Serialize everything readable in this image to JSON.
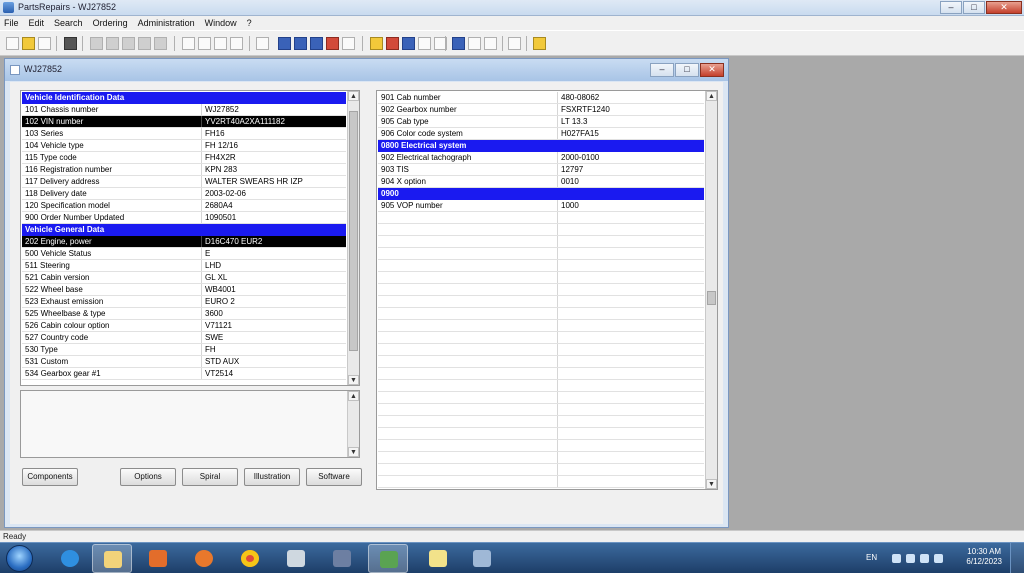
{
  "app": {
    "title": "PartsRepairs - WJ27852",
    "menu": [
      "File",
      "Edit",
      "Search",
      "Ordering",
      "Administration",
      "Window",
      "?"
    ]
  },
  "child": {
    "title": "WJ27852"
  },
  "left_panel": {
    "rows": [
      {
        "type": "header",
        "label": "Vehicle Identification Data",
        "value": ""
      },
      {
        "type": "row",
        "label": "101 Chassis number",
        "value": "WJ27852"
      },
      {
        "type": "selected",
        "label": "102 VIN number",
        "value": "YV2RT40A2XA111182"
      },
      {
        "type": "row",
        "label": "103 Series",
        "value": "FH16"
      },
      {
        "type": "row",
        "label": "104 Vehicle type",
        "value": "FH 12/16"
      },
      {
        "type": "row",
        "label": "115 Type code",
        "value": "FH4X2R"
      },
      {
        "type": "row",
        "label": "116 Registration number",
        "value": "KPN 283"
      },
      {
        "type": "row",
        "label": "117 Delivery address",
        "value": "WALTER SWEARS HR IZP"
      },
      {
        "type": "row",
        "label": "118 Delivery date",
        "value": "2003-02-06"
      },
      {
        "type": "row",
        "label": "120 Specification model",
        "value": "2680A4"
      },
      {
        "type": "row",
        "label": "900 Order Number Updated",
        "value": "1090501"
      },
      {
        "type": "header",
        "label": "Vehicle General Data",
        "value": ""
      },
      {
        "type": "selected",
        "label": "202 Engine, power",
        "value": "D16C470 EUR2"
      },
      {
        "type": "row",
        "label": "500 Vehicle Status",
        "value": "E"
      },
      {
        "type": "row",
        "label": "511 Steering",
        "value": "LHD"
      },
      {
        "type": "row",
        "label": "521 Cabin version",
        "value": "GL XL"
      },
      {
        "type": "row",
        "label": "522 Wheel base",
        "value": "WB4001"
      },
      {
        "type": "row",
        "label": "523 Exhaust emission",
        "value": "EURO 2"
      },
      {
        "type": "row",
        "label": "525 Wheelbase & type",
        "value": "3600"
      },
      {
        "type": "row",
        "label": "526 Cabin colour option",
        "value": "V71121"
      },
      {
        "type": "row",
        "label": "527 Country code",
        "value": "SWE"
      },
      {
        "type": "row",
        "label": "530 Type",
        "value": "FH"
      },
      {
        "type": "row",
        "label": "531 Custom",
        "value": "STD AUX"
      },
      {
        "type": "row",
        "label": "534 Gearbox gear #1",
        "value": "VT2514"
      }
    ]
  },
  "right_panel": {
    "rows": [
      {
        "type": "row",
        "label": "901 Cab number",
        "value": "480-08062"
      },
      {
        "type": "row",
        "label": "902 Gearbox number",
        "value": "FSXRTF1240"
      },
      {
        "type": "row",
        "label": "905 Cab type",
        "value": "LT 13.3"
      },
      {
        "type": "row",
        "label": "906 Color code system",
        "value": "H027FA15"
      },
      {
        "type": "header",
        "label": "0800 Electrical system",
        "value": ""
      },
      {
        "type": "row",
        "label": "902 Electrical tachograph",
        "value": "2000-0100"
      },
      {
        "type": "row",
        "label": "903 TIS",
        "value": "12797"
      },
      {
        "type": "row",
        "label": "904 X option",
        "value": "0010"
      },
      {
        "type": "header",
        "label": "0900",
        "value": ""
      },
      {
        "type": "row",
        "label": "905 VOP number",
        "value": "1000"
      }
    ]
  },
  "buttons": {
    "components": "Components",
    "options": "Options",
    "spiral": "Spiral",
    "illustration": "Illustration",
    "software": "Software"
  },
  "status": {
    "text": "Ready"
  },
  "tray": {
    "lang": "EN",
    "time": "10:30 AM",
    "date": "6/12/2023"
  },
  "colors": {
    "header_blue": "#1a1af0",
    "selected": "#000000",
    "desktop": "#a9a9a9"
  }
}
